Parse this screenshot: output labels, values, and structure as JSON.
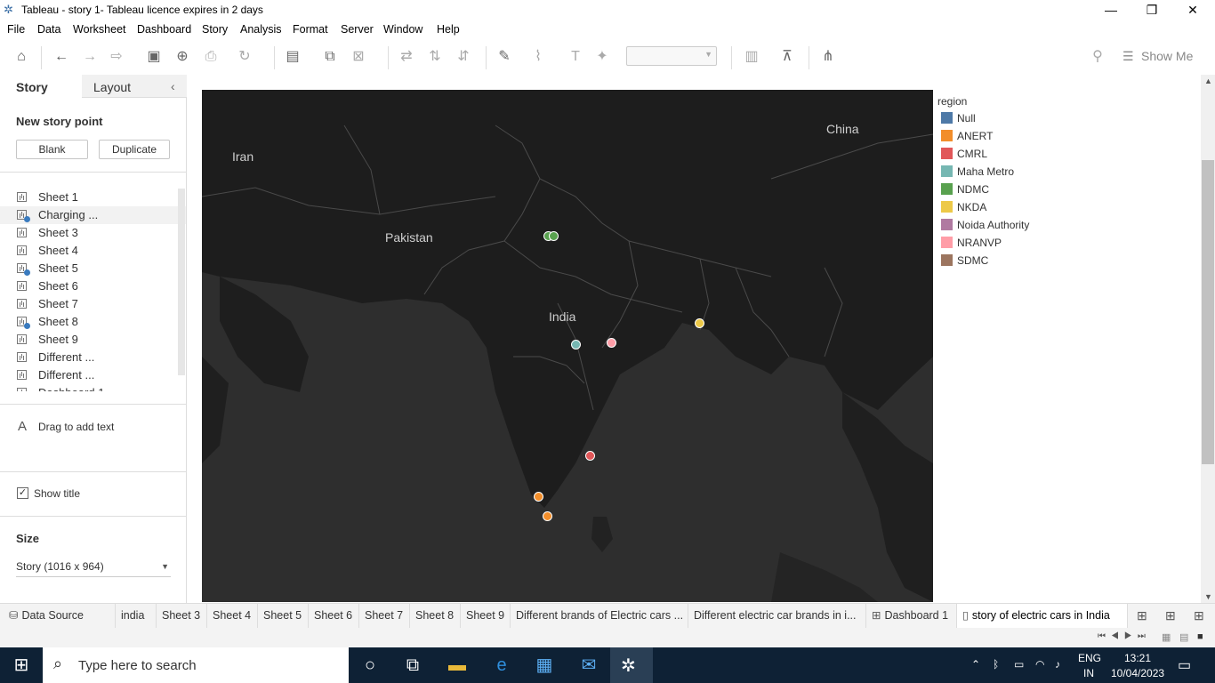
{
  "window": {
    "title": "Tableau - story 1- Tableau licence expires in 2 days",
    "controls": [
      "minimize",
      "restore",
      "close"
    ]
  },
  "menu": [
    "File",
    "Data",
    "Worksheet",
    "Dashboard",
    "Story",
    "Analysis",
    "Format",
    "Server",
    "Window",
    "Help"
  ],
  "toolbar": {
    "show_me": "Show Me",
    "icons": [
      "home-icon",
      "undo-icon",
      "redo-icon",
      "replay-icon",
      "save-icon",
      "add-data-icon",
      "pause-icon",
      "refresh-icon",
      "new-sheet-icon",
      "duplicate-icon",
      "clear-icon",
      "swap-icon",
      "sort-asc-icon",
      "sort-desc-icon",
      "highlight-icon",
      "group-icon",
      "label-icon",
      "pin-icon",
      "fit-icon",
      "presentation-icon",
      "share-icon"
    ]
  },
  "left_pane": {
    "tabs": [
      "Story",
      "Layout"
    ],
    "new_story_point": "New story point",
    "blank_label": "Blank",
    "duplicate_label": "Duplicate",
    "sheets": [
      {
        "label": "Sheet 1",
        "checked": false
      },
      {
        "label": "Charging ...",
        "checked": true
      },
      {
        "label": "Sheet 3",
        "checked": false
      },
      {
        "label": "Sheet 4",
        "checked": false
      },
      {
        "label": "Sheet 5",
        "checked": true
      },
      {
        "label": "Sheet 6",
        "checked": false
      },
      {
        "label": "Sheet 7",
        "checked": false
      },
      {
        "label": "Sheet 8",
        "checked": true
      },
      {
        "label": "Sheet 9",
        "checked": false
      },
      {
        "label": "Different ...",
        "checked": false
      },
      {
        "label": "Different ...",
        "checked": false
      },
      {
        "label": "Dashboard 1",
        "checked": false
      }
    ],
    "drag_text": "Drag to add text",
    "show_title": "Show title",
    "size_heading": "Size",
    "size_value": "Story (1016 x 964)"
  },
  "map": {
    "labels": [
      {
        "text": "Iran"
      },
      {
        "text": "Pakistan"
      },
      {
        "text": "India"
      },
      {
        "text": "China"
      }
    ]
  },
  "legend": {
    "title": "region",
    "items": [
      {
        "label": "Null",
        "color": "#4e79a7"
      },
      {
        "label": "ANERT",
        "color": "#f28e2b"
      },
      {
        "label": "CMRL",
        "color": "#e15759"
      },
      {
        "label": "Maha Metro",
        "color": "#76b7b2"
      },
      {
        "label": "NDMC",
        "color": "#59a14f"
      },
      {
        "label": "NKDA",
        "color": "#edc948"
      },
      {
        "label": "Noida Authority",
        "color": "#b07aa1"
      },
      {
        "label": "NRANVP",
        "color": "#ff9da7"
      },
      {
        "label": "SDMC",
        "color": "#9c755f"
      }
    ]
  },
  "sheet_tabs": [
    "Data Source",
    "india",
    "Sheet 3",
    "Sheet 4",
    "Sheet 5",
    "Sheet 6",
    "Sheet 7",
    "Sheet 8",
    "Sheet 9",
    "Different brands of Electric cars ...",
    "Different electric car brands in i...",
    "Dashboard 1",
    "story of electric cars in India"
  ],
  "taskbar": {
    "search_placeholder": "Type here to search",
    "lang": "ENG",
    "region": "IN",
    "time": "13:21",
    "date": "10/04/2023"
  }
}
